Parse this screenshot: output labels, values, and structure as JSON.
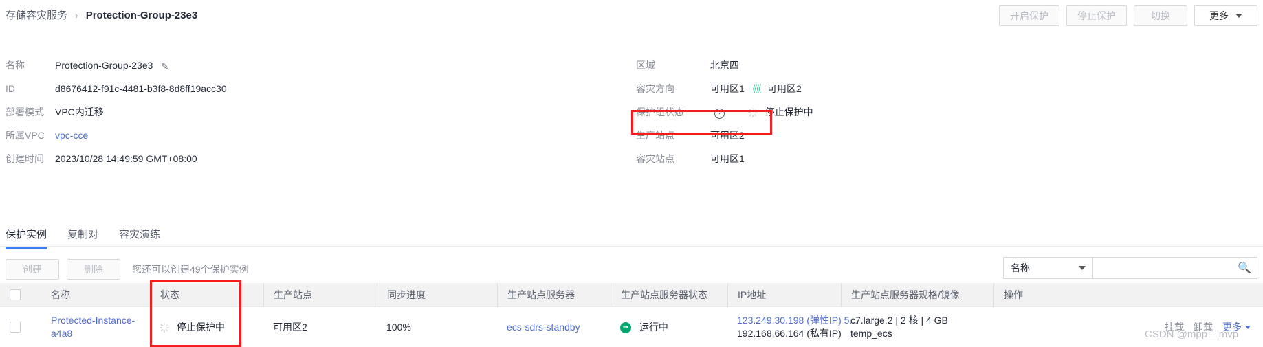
{
  "breadcrumb": {
    "root": "存储容灾服务",
    "separator": "›",
    "current": "Protection-Group-23e3"
  },
  "top_actions": [
    {
      "label": "开启保护",
      "enabled": false,
      "name": "start-protection-button"
    },
    {
      "label": "停止保护",
      "enabled": false,
      "name": "stop-protection-button"
    },
    {
      "label": "切换",
      "enabled": false,
      "name": "switch-button"
    },
    {
      "label": "更多",
      "enabled": true,
      "name": "more-button"
    }
  ],
  "details": {
    "left": [
      {
        "label": "名称",
        "value": "Protection-Group-23e3",
        "editable": true
      },
      {
        "label": "ID",
        "value": "d8676412-f91c-4481-b3f8-8d8ff19acc30"
      },
      {
        "label": "部署模式",
        "value": "VPC内迁移"
      },
      {
        "label": "所属VPC",
        "value": "vpc-cce",
        "is_link": true
      },
      {
        "label": "创建时间",
        "value": "2023/10/28 14:49:59 GMT+08:00"
      }
    ],
    "right": {
      "region": {
        "label": "区域",
        "value": "北京四"
      },
      "direction": {
        "label": "容灾方向",
        "from": "可用区1",
        "arrows": "⟨⟨⟨⟨",
        "to": "可用区2"
      },
      "group_status": {
        "label": "保护组状态",
        "help": "?",
        "value": "停止保护中"
      },
      "production_site": {
        "label": "生产站点",
        "value": "可用区2"
      },
      "dr_site": {
        "label": "容灾站点",
        "value": "可用区1"
      }
    }
  },
  "tabs": [
    {
      "label": "保护实例",
      "active": true
    },
    {
      "label": "复制对",
      "active": false
    },
    {
      "label": "容灾演练",
      "active": false
    }
  ],
  "toolbar": {
    "create_label": "创建",
    "delete_label": "删除",
    "tip": "您还可以创建49个保护实例"
  },
  "search": {
    "select_value": "名称",
    "input_value": "",
    "placeholder": "",
    "icon": "search-icon"
  },
  "table": {
    "headers": [
      "名称",
      "状态",
      "生产站点",
      "同步进度",
      "生产站点服务器",
      "生产站点服务器状态",
      "IP地址",
      "生产站点服务器规格/镜像",
      "操作"
    ],
    "rows": [
      {
        "name": "Protected-Instance-a4a8",
        "status": "停止保护中",
        "site": "可用区2",
        "progress": "100%",
        "server": "ecs-sdrs-standby",
        "server_status": "运行中",
        "ip_elastic": "123.249.30.198 (弹性IP) 5...",
        "ip_private": "192.168.66.164 (私有IP)",
        "spec_flavor": "c7.large.2 | 2 核 | 4 GB",
        "spec_image": "temp_ecs",
        "actions": [
          {
            "label": "挂载",
            "enabled": false
          },
          {
            "label": "卸载",
            "enabled": false
          },
          {
            "label": "更多",
            "enabled": true
          }
        ]
      }
    ]
  },
  "watermark": "CSDN @mpp__mvp",
  "colors": {
    "accent": "#3c7eff",
    "link": "#526ecc",
    "success": "#3ac295",
    "highlight": "#f41c1c",
    "chevron": "#4fc3a1"
  }
}
